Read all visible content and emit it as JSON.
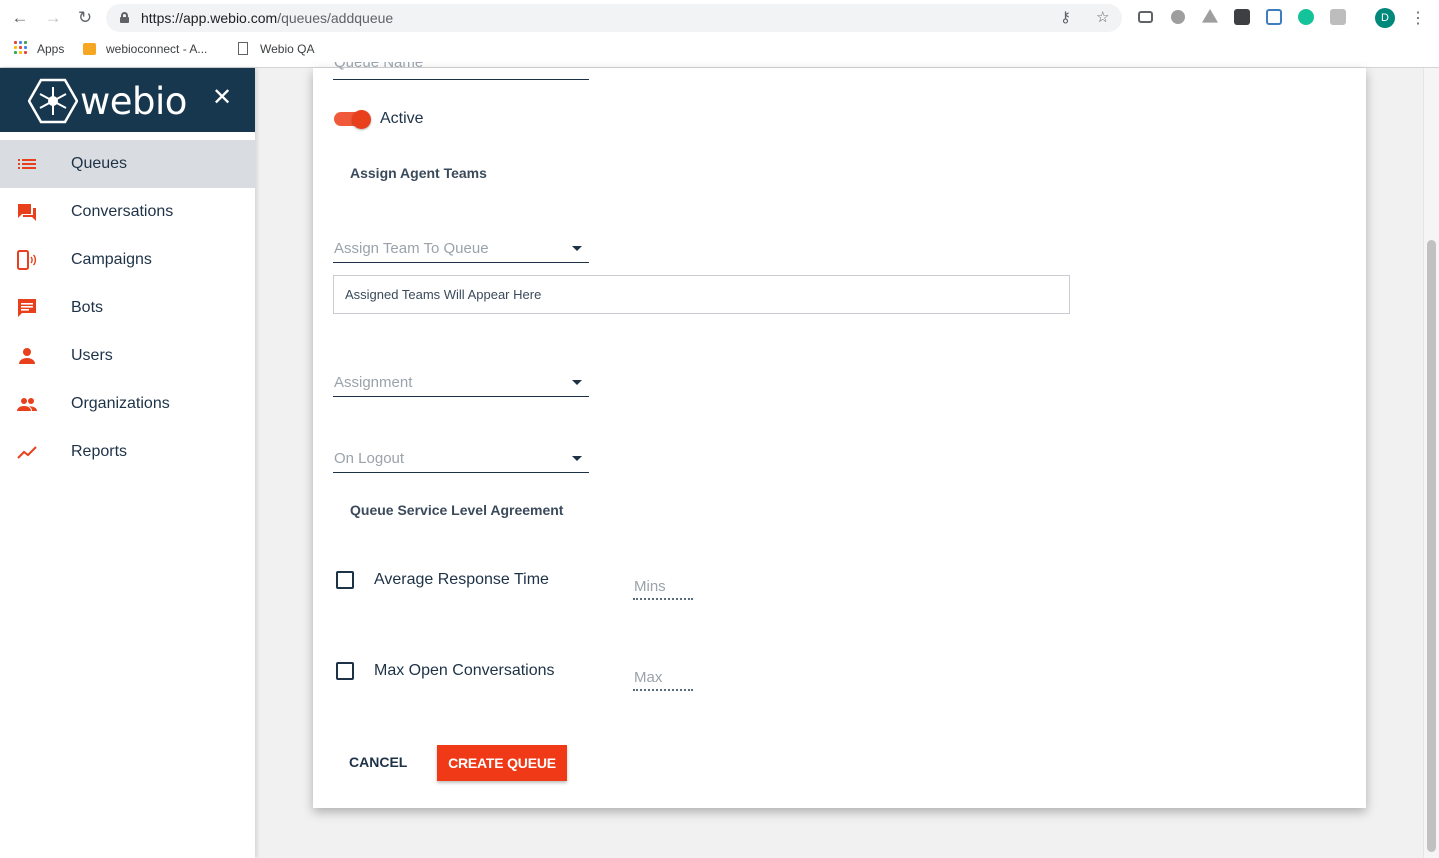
{
  "browser": {
    "url_host": "https://app.webio.com",
    "url_path": "/queues/addqueue",
    "bookmarks": [
      "Apps",
      "webioconnect - A...",
      "Webio QA"
    ],
    "profile_initial": "D"
  },
  "sidebar": {
    "brand": "webio",
    "close_label": "✕",
    "items": [
      {
        "label": "Queues",
        "icon": "list-icon",
        "active": true
      },
      {
        "label": "Conversations",
        "icon": "chat-icon",
        "active": false
      },
      {
        "label": "Campaigns",
        "icon": "phone-broadcast-icon",
        "active": false
      },
      {
        "label": "Bots",
        "icon": "message-icon",
        "active": false
      },
      {
        "label": "Users",
        "icon": "person-icon",
        "active": false
      },
      {
        "label": "Organizations",
        "icon": "people-icon",
        "active": false
      },
      {
        "label": "Reports",
        "icon": "trend-icon",
        "active": false
      }
    ]
  },
  "form": {
    "queue_name_placeholder": "Queue Name",
    "active_label": "Active",
    "active_on": true,
    "assign_agent_teams_title": "Assign Agent Teams",
    "assign_team_placeholder": "Assign Team To Queue",
    "assigned_teams_text": "Assigned Teams Will Appear Here",
    "assignment_placeholder": "Assignment",
    "on_logout_placeholder": "On Logout",
    "sla_title": "Queue Service Level Agreement",
    "avg_response_label": "Average Response Time",
    "avg_response_placeholder": "Mins",
    "max_open_label": "Max Open Conversations",
    "max_open_placeholder": "Max",
    "cancel_label": "CANCEL",
    "create_label": "CREATE QUEUE"
  },
  "colors": {
    "accent": "#f03a17",
    "navy": "#17374f",
    "active_nav_bg": "#d9dde2"
  }
}
